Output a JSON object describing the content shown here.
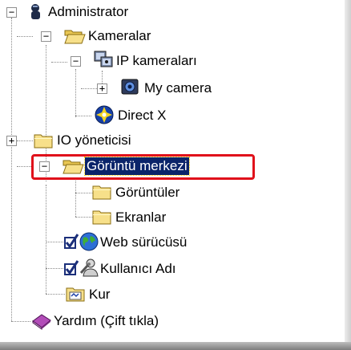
{
  "tree": {
    "nodes": [
      {
        "label": "Administrator",
        "icon": "admin-user-icon",
        "expander": "−"
      },
      {
        "label": "Kameralar",
        "icon": "open-folder-icon",
        "expander": "−"
      },
      {
        "label": "IP kameraları",
        "icon": "ip-camera-group-icon",
        "expander": "−"
      },
      {
        "label": "My camera",
        "icon": "camera-icon",
        "expander": "+"
      },
      {
        "label": "Direct X",
        "icon": "directx-icon"
      },
      {
        "label": "IO yöneticisi",
        "icon": "folder-icon",
        "expander": "+"
      },
      {
        "label": "Görüntü merkezi",
        "icon": "open-folder-icon",
        "expander": "−",
        "selected": true
      },
      {
        "label": "Görüntüler",
        "icon": "folder-icon"
      },
      {
        "label": "Ekranlar",
        "icon": "folder-icon"
      },
      {
        "label": "Web sürücüsü",
        "icon": "web-globe-icon",
        "checked": true
      },
      {
        "label": "Kullanıcı Adı",
        "icon": "user-tools-icon",
        "checked": true
      },
      {
        "label": "Kur",
        "icon": "setup-folder-icon"
      },
      {
        "label": "Yardım (Çift tıkla)",
        "icon": "help-book-icon"
      }
    ]
  },
  "colors": {
    "selection_bg": "#0a246a",
    "highlight_border": "#e0111b",
    "folder_yellow": "#f7e08a"
  }
}
